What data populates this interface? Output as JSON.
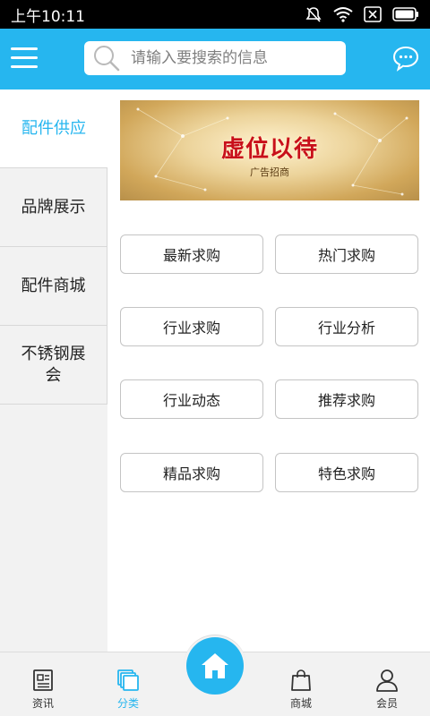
{
  "status_bar": {
    "time": "上午10:11",
    "icons": [
      "mute-icon",
      "wifi-icon",
      "sim-icon",
      "battery-icon"
    ]
  },
  "header": {
    "menu_icon": "menu-icon",
    "search": {
      "placeholder": "请输入要搜索的信息",
      "value": ""
    },
    "chat_icon": "chat-bubble-icon"
  },
  "sidebar": {
    "items": [
      {
        "label": "配件供应",
        "active": true
      },
      {
        "label": "品牌展示",
        "active": false
      },
      {
        "label": "配件商城",
        "active": false
      },
      {
        "label": "不锈钢展会",
        "active": false
      }
    ]
  },
  "banner": {
    "title": "虚位以待",
    "subtitle": "广告招商"
  },
  "buttons": [
    {
      "label": "最新求购"
    },
    {
      "label": "热门求购"
    },
    {
      "label": "行业求购"
    },
    {
      "label": "行业分析"
    },
    {
      "label": "行业动态"
    },
    {
      "label": "推荐求购"
    },
    {
      "label": "精品求购"
    },
    {
      "label": "特色求购"
    }
  ],
  "bottom_nav": {
    "items": [
      {
        "label": "资讯",
        "icon": "news-icon",
        "active": false
      },
      {
        "label": "分类",
        "icon": "category-icon",
        "active": true
      },
      {
        "label": "",
        "icon": "home-icon",
        "active": false
      },
      {
        "label": "商城",
        "icon": "shopping-bag-icon",
        "active": false
      },
      {
        "label": "会员",
        "icon": "user-icon",
        "active": false
      }
    ]
  },
  "colors": {
    "accent": "#26b6ef",
    "status_bar": "#000000",
    "sidebar_bg": "#f2f2f2",
    "banner_title": "#c8101a"
  }
}
